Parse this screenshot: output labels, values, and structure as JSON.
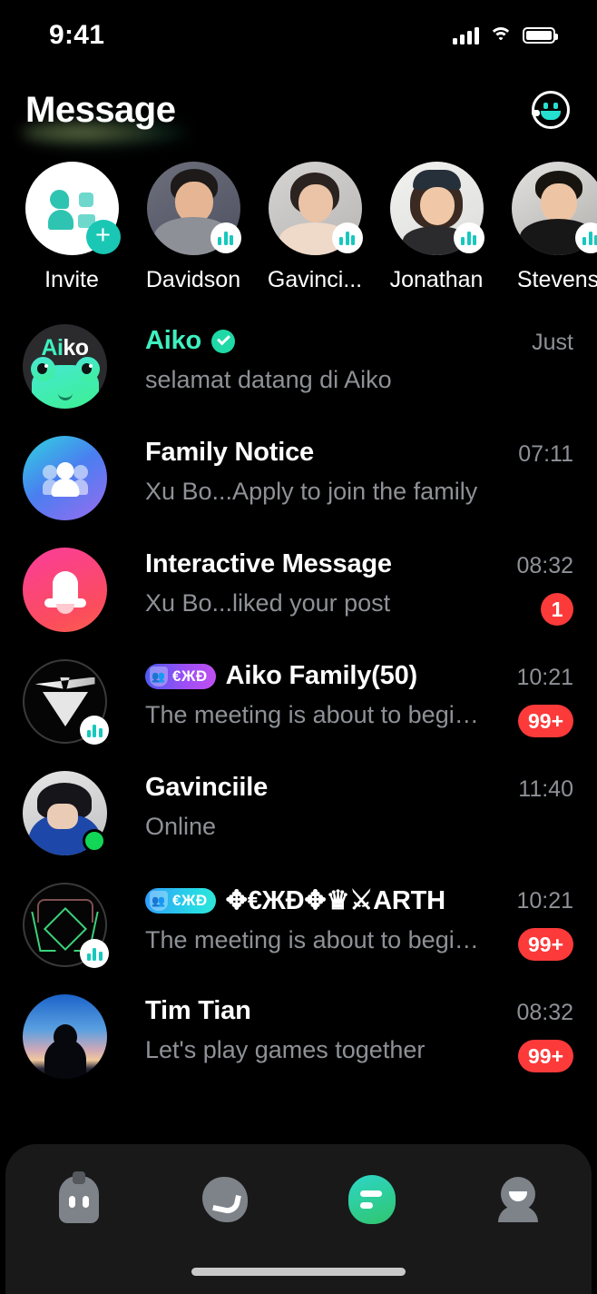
{
  "status_bar": {
    "time": "9:41",
    "signal_icon": "cellular-signal-icon",
    "wifi_icon": "wifi-icon",
    "battery_icon": "battery-icon"
  },
  "header": {
    "title": "Message",
    "action_icon": "smiley-face-icon"
  },
  "stories": [
    {
      "name": "Invite",
      "type": "invite",
      "indicator": "plus-icon",
      "plus": "+"
    },
    {
      "name": "Davidson",
      "type": "photo",
      "indicator": "live-audio-icon"
    },
    {
      "name": "Gavinci...",
      "type": "photo",
      "indicator": "live-audio-icon"
    },
    {
      "name": "Jonathan",
      "type": "photo",
      "indicator": "live-audio-icon"
    },
    {
      "name": "Stevens",
      "type": "photo",
      "indicator": "live-audio-icon"
    }
  ],
  "conversations": [
    {
      "avatar": "aiko-mascot",
      "name": "Aiko",
      "name_parts": {
        "mint": "Ai",
        "white": "ko"
      },
      "verified": true,
      "preview": "selamat datang di Aiko",
      "time": "Just",
      "badge": "",
      "group_tag": ""
    },
    {
      "avatar": "family-notice",
      "name": "Family Notice",
      "verified": false,
      "preview": "Xu Bo...Apply to join the family",
      "time": "07:11",
      "badge": "",
      "group_tag": ""
    },
    {
      "avatar": "interactive-bell",
      "name": "Interactive Message",
      "verified": false,
      "preview": "Xu Bo...liked your post",
      "time": "08:32",
      "badge": "1",
      "group_tag": ""
    },
    {
      "avatar": "v-emblem",
      "name": "Aiko Family(50)",
      "verified": false,
      "preview": "The meeting is about to begin...",
      "time": "10:21",
      "badge": "99+",
      "group_tag": "€ЖÐ",
      "group_tag_style": "purple",
      "live": true
    },
    {
      "avatar": "gavinciile-photo",
      "name": "Gavinciile",
      "verified": false,
      "preview": "Online",
      "time": "11:40",
      "badge": "",
      "group_tag": "",
      "online": true
    },
    {
      "avatar": "demon-emblem",
      "name": "✥€ЖÐ✥♛⚔ARTH",
      "verified": false,
      "preview": "The meeting is about to begin...",
      "time": "10:21",
      "badge": "99+",
      "group_tag": "€ЖÐ",
      "group_tag_style": "cyan",
      "live": true
    },
    {
      "avatar": "tim-tian-photo",
      "name": "Tim Tian",
      "verified": false,
      "preview": "Let's play games together",
      "time": "08:32",
      "badge": "99+",
      "group_tag": ""
    }
  ],
  "tabbar": {
    "items": [
      {
        "icon": "home-icon",
        "active": false
      },
      {
        "icon": "discover-icon",
        "active": false
      },
      {
        "icon": "message-icon",
        "active": true
      },
      {
        "icon": "profile-icon",
        "active": false
      }
    ]
  },
  "colors": {
    "background": "#000000",
    "accent_mint": "#2ed6c8",
    "badge_red": "#fc3a3a",
    "muted_text": "#8e9196",
    "tabbar_bg": "#191919"
  }
}
